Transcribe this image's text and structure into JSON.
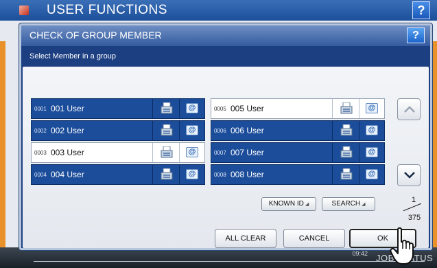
{
  "app": {
    "title": "USER FUNCTIONS",
    "help_label": "?",
    "clock": "09:42",
    "job_status_label": "JOB STATUS"
  },
  "dialog": {
    "title": "CHECK OF GROUP MEMBER",
    "help_label": "?",
    "subtitle": "Select Member in a group"
  },
  "members": [
    {
      "num": "0001",
      "name": "001 User",
      "selected": false
    },
    {
      "num": "0002",
      "name": "002 User",
      "selected": false
    },
    {
      "num": "0003",
      "name": "003 User",
      "selected": true
    },
    {
      "num": "0004",
      "name": "004 User",
      "selected": false
    },
    {
      "num": "0005",
      "name": "005 User",
      "selected": true
    },
    {
      "num": "0006",
      "name": "006 User",
      "selected": false
    },
    {
      "num": "0007",
      "name": "007 User",
      "selected": false
    },
    {
      "num": "0008",
      "name": "008 User",
      "selected": false
    }
  ],
  "paging": {
    "current": "1",
    "total": "375"
  },
  "buttons": {
    "known_id": "KNOWN ID",
    "search": "SEARCH",
    "all_clear": "ALL CLEAR",
    "cancel": "CANCEL",
    "ok": "OK"
  },
  "icons": {
    "fax": "fax-icon",
    "email": "email-icon",
    "page_up": "chevron-up-icon",
    "page_down": "chevron-down-icon",
    "cursor": "hand-pointer-icon"
  },
  "colors": {
    "dialog_blue": "#1c3f82",
    "tile_blue": "#1c4d9b",
    "title_gradient_top": "#6f8fc4",
    "accent_orange": "#e8902a"
  }
}
